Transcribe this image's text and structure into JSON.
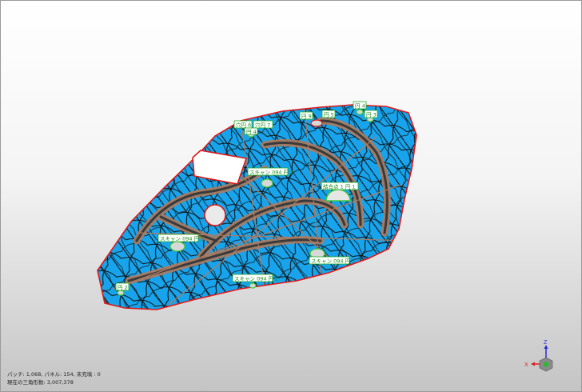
{
  "window": {
    "title": ""
  },
  "labels": [
    {
      "text": "穴円 6"
    },
    {
      "text": "穴円 7"
    },
    {
      "text": "円 4"
    },
    {
      "text": "円 9"
    },
    {
      "text": "円 5"
    },
    {
      "text": "円 4"
    },
    {
      "text": "円 3"
    },
    {
      "text": "スキャン 094 円 3"
    },
    {
      "text": "結合点 1 円 1"
    },
    {
      "text": "スキャン 094 円 5"
    },
    {
      "text": "スキャン 094 円 1"
    },
    {
      "text": "スキャン 094 円 2"
    },
    {
      "text": "円 2"
    }
  ],
  "status": {
    "line1": "パッチ: 1,068, パネル: 154, 未充填 : 0",
    "line2": "現在の三角形数: 3,007,378"
  },
  "axis": {
    "x_label": "X",
    "z_label": "Z"
  },
  "colors": {
    "surface": "#18a4ec",
    "mesh": "#101010",
    "patch_edge": "#b07a5e",
    "boundary": "#e01818",
    "label_green": "#1b8a1b"
  }
}
